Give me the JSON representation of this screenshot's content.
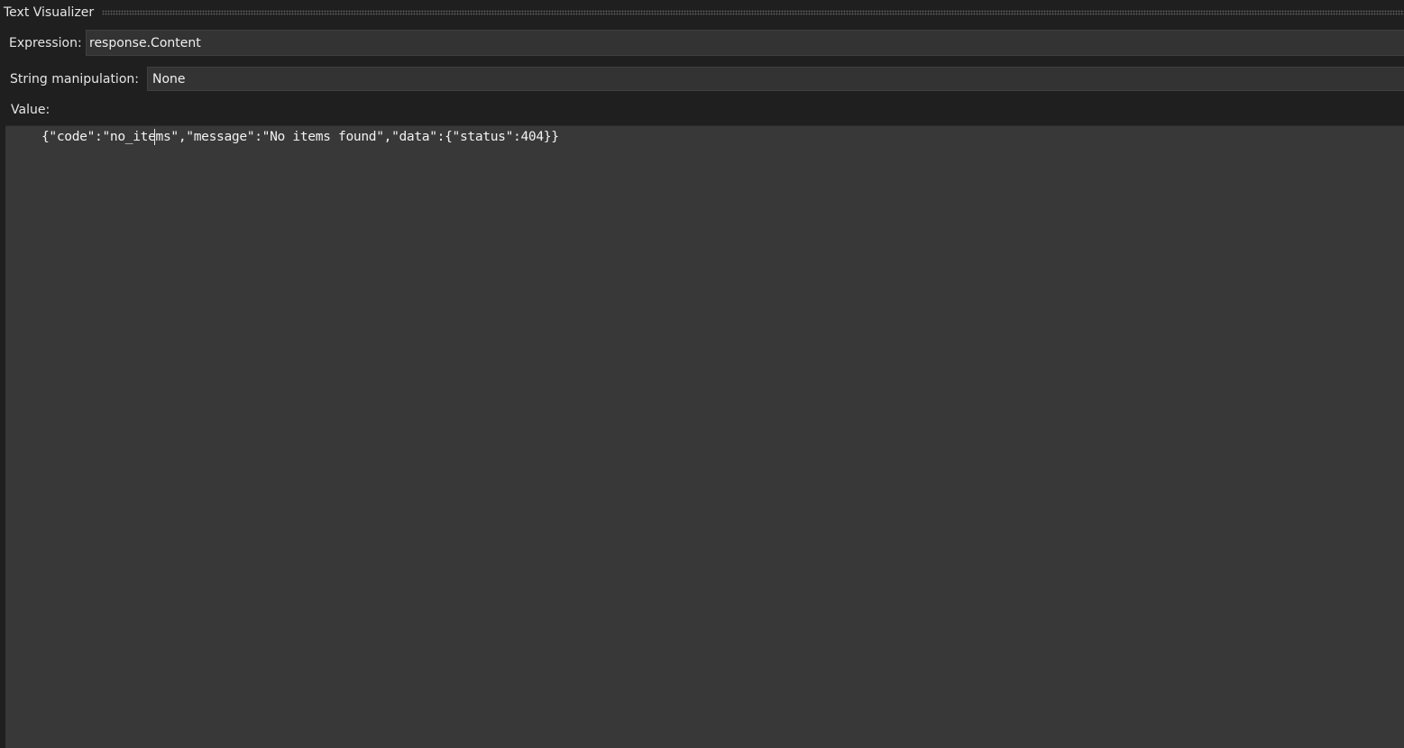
{
  "window": {
    "title": "Text Visualizer"
  },
  "expression": {
    "label": "Expression:",
    "value": "response.Content"
  },
  "string_manipulation": {
    "label": "String manipulation:",
    "value": "None"
  },
  "value": {
    "label": "Value:",
    "content": "{\"code\":\"no_items\",\"message\":\"No items found\",\"data\":{\"status\":404}}"
  }
}
